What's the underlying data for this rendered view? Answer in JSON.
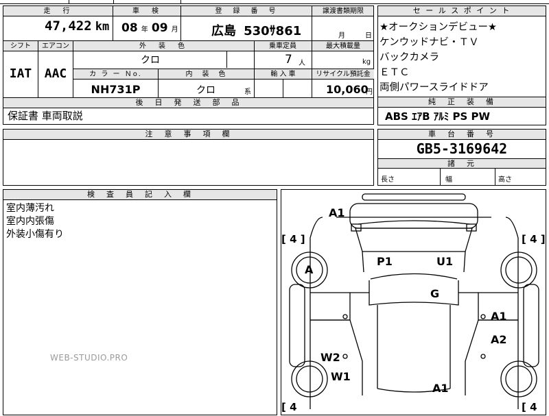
{
  "top": {
    "mileage_header": "走　行",
    "inspection_header": "車　検",
    "registration_header": "登　録　番　号",
    "transfer_header": "譲渡書類期限",
    "mileage_value": "47,422",
    "mileage_unit": "km",
    "inspection_year": "08",
    "year_unit": "年",
    "inspection_month": "09",
    "month_unit": "月",
    "plate_region": "広島",
    "plate_number": "530ｻ861",
    "transfer_month_unit": "月",
    "transfer_day_unit": "日"
  },
  "row2": {
    "shift_header": "シフト",
    "ac_header": "エアコン",
    "exterior_color_header": "外　装　色",
    "capacity_header": "乗車定員",
    "max_load_header": "最大積載量",
    "shift_value": "IAT",
    "ac_value": "AAC",
    "exterior_color_value": "クロ",
    "capacity_value": "7",
    "capacity_unit": "人",
    "load_unit": "kg",
    "color_no_header": "カ ラ ー Ｎo.",
    "interior_header": "内　装　色",
    "import_header": "輸 入 車",
    "recycle_header": "リサイクル預託金",
    "color_no_value": "NH731P",
    "interior_value": "クロ",
    "interior_suffix": "系",
    "recycle_value": "10,060",
    "recycle_unit": "円"
  },
  "parts": {
    "header": "後　日　発　送　部　品",
    "value": "保証書 車両取説"
  },
  "notes": {
    "header": "注　意　事　項　欄"
  },
  "sales_points": {
    "header": "セ ー ル ス ポ イ ン ト",
    "items": [
      "★オークションデビュー★",
      "ケンウッドナビ・ＴＶ",
      "バックカメラ",
      "ＥＴＣ",
      "両側パワースライドドア"
    ]
  },
  "equipment": {
    "header": "純　正　装　備",
    "value": "ABS ｴｱB ｱﾙﾐ PS PW"
  },
  "chassis": {
    "header": "車　台　番　号",
    "value": "GB5-3169642"
  },
  "dimensions": {
    "header": "諸　元",
    "length": "長さ",
    "width": "幅",
    "height": "高さ"
  },
  "inspector": {
    "header": "検　査　員　記　入　欄",
    "lines": [
      "室内薄汚れ",
      "室内内張傷",
      "外装小傷有り"
    ]
  },
  "watermark": "WEB-STUDIO.PRO",
  "diagram": {
    "tire_tl": "[ 4 ]",
    "tire_tr": "[ 4 ]",
    "tire_bl": "[ 4",
    "tire_br": "[ 4",
    "marks": [
      "A1",
      "A",
      "P1",
      "U1",
      "G",
      "A1",
      "A2",
      "W2",
      "W1",
      "A1"
    ]
  }
}
